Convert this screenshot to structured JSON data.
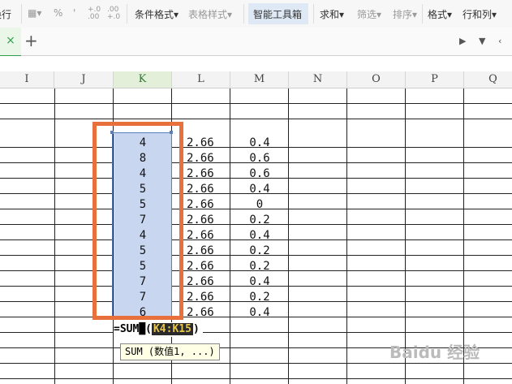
{
  "toolbar": {
    "wrap_text_partial": "换行",
    "percent": "%",
    "thousands": "'",
    "inc_decimal": "+.0 .00",
    "dec_decimal": ".00 +.0",
    "conditional_format": "条件格式",
    "table_style": "表格样式",
    "smart_toolbox": "智能工具箱",
    "sum": "求和",
    "filter": "筛选",
    "sort": "排序",
    "format": "格式",
    "row_col": "行和列"
  },
  "tabs": {
    "close": "×",
    "add": "+"
  },
  "columns": [
    "I",
    "J",
    "K",
    "L",
    "M",
    "N",
    "O",
    "P",
    "Q"
  ],
  "selected_column": "K",
  "rows": [
    {
      "k": "4",
      "l": "2.66",
      "m": "0.4"
    },
    {
      "k": "8",
      "l": "2.66",
      "m": "0.6"
    },
    {
      "k": "4",
      "l": "2.66",
      "m": "0.6"
    },
    {
      "k": "5",
      "l": "2.66",
      "m": "0.4"
    },
    {
      "k": "5",
      "l": "2.66",
      "m": "0"
    },
    {
      "k": "7",
      "l": "2.66",
      "m": "0.2"
    },
    {
      "k": "4",
      "l": "2.66",
      "m": "0.4"
    },
    {
      "k": "5",
      "l": "2.66",
      "m": "0.2"
    },
    {
      "k": "5",
      "l": "2.66",
      "m": "0.2"
    },
    {
      "k": "7",
      "l": "2.66",
      "m": "0.4"
    },
    {
      "k": "7",
      "l": "2.66",
      "m": "0.2"
    },
    {
      "k": "6",
      "l": "2.66",
      "m": "0.4"
    }
  ],
  "formula": {
    "prefix": "=SUM",
    "open": "(",
    "ref": "K4:K15",
    "close": ")"
  },
  "tooltip": "SUM (数值1, ...)",
  "watermark": "Baidu 经验",
  "colors": {
    "selection_fill": "#c9d6f0",
    "highlight_box": "#e8703d",
    "active_tab": "#2f9e4c"
  }
}
